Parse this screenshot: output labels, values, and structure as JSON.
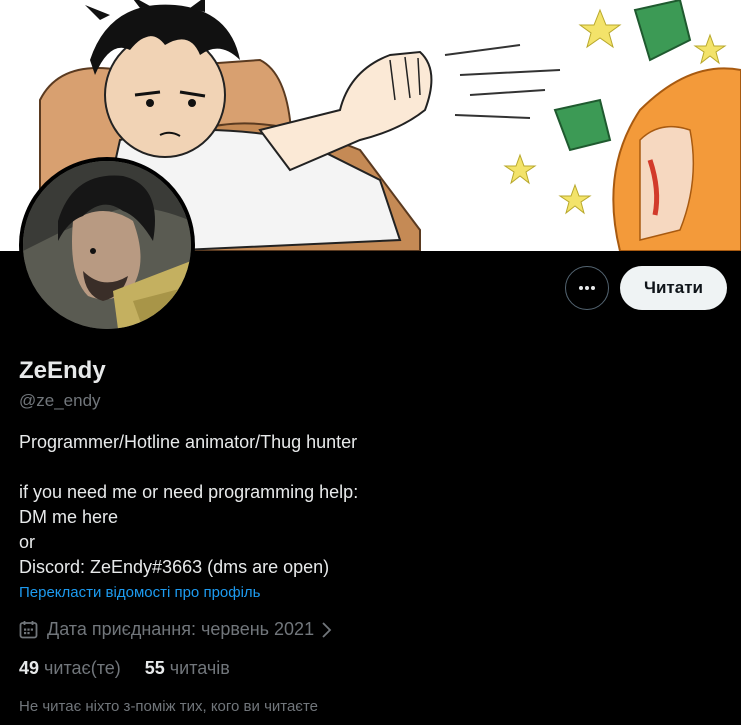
{
  "profile": {
    "name": "ZeEndy",
    "handle": "@ze_endy",
    "bio_lines": [
      "Programmer/Hotline animator/Thug hunter",
      "",
      "if you need me or need programming help:",
      "DM me here",
      "or",
      "Discord: ZeEndy#3663 (dms are open)"
    ],
    "translate_link": "Перекласти відомості про профіль",
    "joined": "Дата приєднання: червень 2021",
    "following_count": "49",
    "following_label": "читає(те)",
    "followers_count": "55",
    "followers_label": "читачів",
    "mutual_note": "Не читає ніхто з-поміж тих, кого ви читаєте"
  },
  "actions": {
    "more_icon": "more-dots-icon",
    "follow_label": "Читати"
  },
  "icons": {
    "joined": "calendar-icon",
    "joined_chevron": "chevron-right-icon"
  },
  "colors": {
    "background": "#000000",
    "text_primary": "#e7e9ea",
    "text_secondary": "#71767b",
    "link": "#1d9bf0",
    "follow_button_bg": "#eff3f4",
    "follow_button_text": "#0f1419",
    "border": "#536471"
  }
}
